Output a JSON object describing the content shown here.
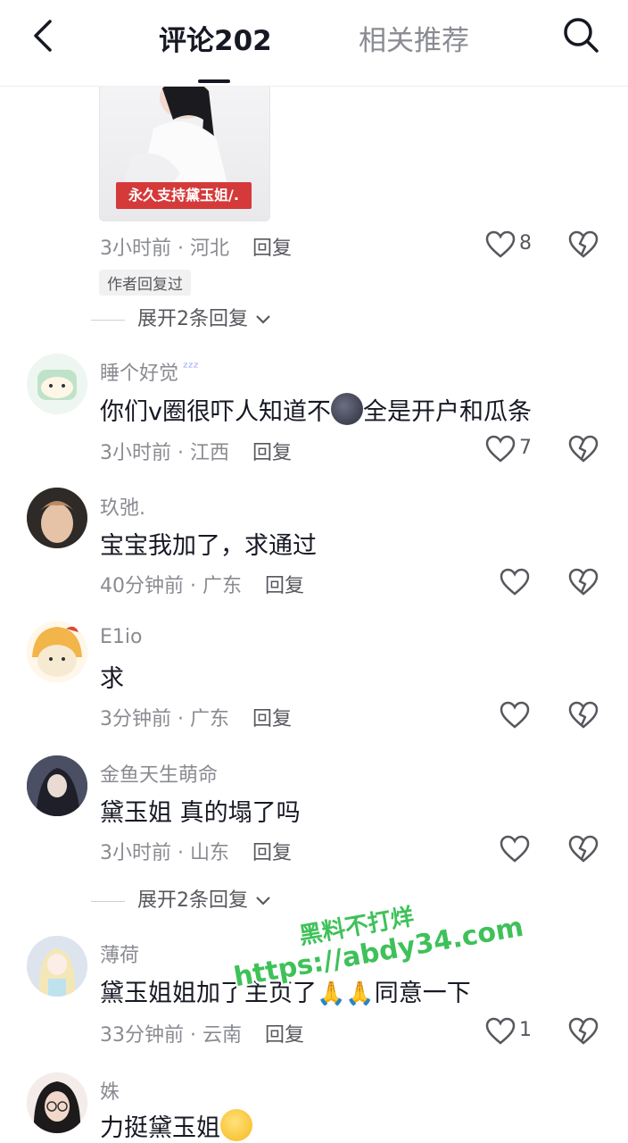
{
  "header": {
    "tab_comments": "评论202",
    "tab_related": "相关推荐"
  },
  "image_banner": "永久支持黛玉姐/.",
  "top_comment": {
    "time": "3小时前",
    "region": "河北",
    "reply": "回复",
    "likes": "8",
    "author_badge": "作者回复过",
    "expand": "展开2条回复"
  },
  "comments": [
    {
      "username": "睡个好觉",
      "body_a": "你们v圈很吓人知道不",
      "body_b": "全是开户和瓜条",
      "time": "3小时前",
      "region": "江西",
      "reply": "回复",
      "likes": "7"
    },
    {
      "username": "玖弛.",
      "body": "宝宝我加了，求通过",
      "time": "40分钟前",
      "region": "广东",
      "reply": "回复"
    },
    {
      "username": "E1io",
      "body": "求",
      "time": "3分钟前",
      "region": "广东",
      "reply": "回复"
    },
    {
      "username": "金鱼天生萌命",
      "body": "黛玉姐 真的塌了吗",
      "time": "3小时前",
      "region": "山东",
      "reply": "回复",
      "expand": "展开2条回复"
    },
    {
      "username": "薄荷",
      "body_a": "黛玉姐姐加了主页了",
      "body_b": "同意一下",
      "time": "33分钟前",
      "region": "云南",
      "reply": "回复",
      "likes": "1"
    },
    {
      "username": "姝",
      "body": "力挺黛玉姐"
    }
  ],
  "watermark": {
    "line1": "黑料不打烊",
    "line2": "https://abdy34.com"
  },
  "colors": {
    "text_primary": "#161823",
    "text_secondary": "#8a8b91",
    "watermark_green": "#3fc15a",
    "banner_red": "#d53a3a"
  }
}
